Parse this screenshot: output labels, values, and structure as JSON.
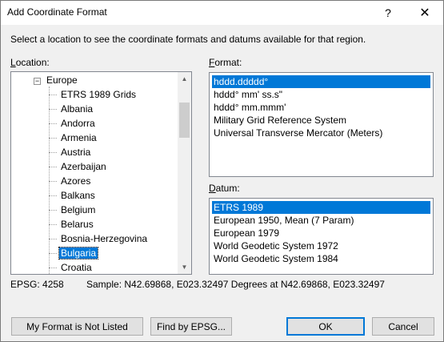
{
  "window": {
    "title": "Add Coordinate Format",
    "help_label": "?",
    "close_label": "✕"
  },
  "instructions": "Select a location to see the coordinate formats and datums available for that region.",
  "location": {
    "label_key": "L",
    "label_rest": "ocation:",
    "tree": [
      {
        "label": "Europe",
        "level": 0,
        "expander": "−"
      },
      {
        "label": "ETRS 1989 Grids",
        "level": 1
      },
      {
        "label": "Albania",
        "level": 1
      },
      {
        "label": "Andorra",
        "level": 1
      },
      {
        "label": "Armenia",
        "level": 1
      },
      {
        "label": "Austria",
        "level": 1
      },
      {
        "label": "Azerbaijan",
        "level": 1
      },
      {
        "label": "Azores",
        "level": 1
      },
      {
        "label": "Balkans",
        "level": 1
      },
      {
        "label": "Belgium",
        "level": 1
      },
      {
        "label": "Belarus",
        "level": 1
      },
      {
        "label": "Bosnia-Herzegovina",
        "level": 1
      },
      {
        "label": "Bulgaria",
        "level": 1,
        "selected": true
      },
      {
        "label": "Croatia",
        "level": 1
      }
    ]
  },
  "format": {
    "label_key": "F",
    "label_rest": "ormat:",
    "items": [
      {
        "label": "hddd.ddddd°",
        "selected": true
      },
      {
        "label": "hddd° mm' ss.s\""
      },
      {
        "label": "hddd° mm.mmm'"
      },
      {
        "label": "Military Grid Reference System"
      },
      {
        "label": "Universal Transverse Mercator (Meters)"
      }
    ]
  },
  "datum": {
    "label_key": "D",
    "label_rest": "atum:",
    "items": [
      {
        "label": "ETRS 1989",
        "selected": true
      },
      {
        "label": "European 1950, Mean (7 Param)"
      },
      {
        "label": "European 1979"
      },
      {
        "label": "World Geodetic System 1972"
      },
      {
        "label": "World Geodetic System 1984"
      }
    ]
  },
  "epsg": "EPSG: 4258",
  "sample": "Sample: N42.69868, E023.32497 Degrees at N42.69868, E023.32497",
  "buttons": {
    "not_listed": "My Format is Not Listed",
    "find_epsg": "Find by EPSG...",
    "ok": "OK",
    "cancel": "Cancel"
  },
  "colors": {
    "selection": "#0078d7",
    "dialog_bg": "#f0f0f0"
  }
}
